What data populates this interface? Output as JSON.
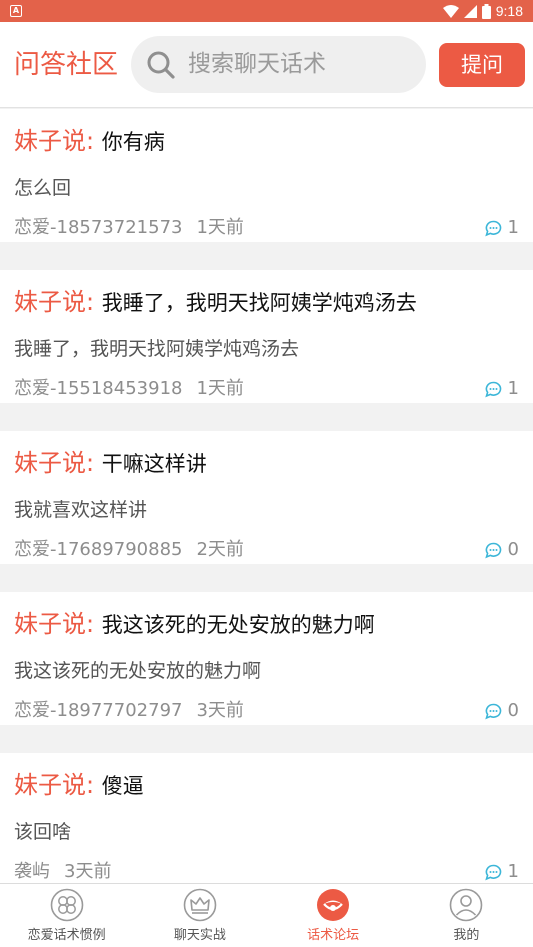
{
  "status_bar": {
    "time": "9:18",
    "app_badge": "A"
  },
  "header": {
    "title": "问答社区",
    "search_placeholder": "搜索聊天话术",
    "ask_button": "提问"
  },
  "posts": [
    {
      "prefix": "妹子说:",
      "question": "你有病",
      "answer": "怎么回",
      "author": "恋爱-18573721573",
      "ago": "1天前",
      "comments": "1"
    },
    {
      "prefix": "妹子说:",
      "question": "我睡了，我明天找阿姨学炖鸡汤去",
      "answer": "我睡了，我明天找阿姨学炖鸡汤去",
      "author": "恋爱-15518453918",
      "ago": "1天前",
      "comments": "1"
    },
    {
      "prefix": "妹子说:",
      "question": "干嘛这样讲",
      "answer": "我就喜欢这样讲",
      "author": "恋爱-17689790885",
      "ago": "2天前",
      "comments": "0"
    },
    {
      "prefix": "妹子说:",
      "question": "我这该死的无处安放的魅力啊",
      "answer": "我这该死的无处安放的魅力啊",
      "author": "恋爱-18977702797",
      "ago": "3天前",
      "comments": "0"
    },
    {
      "prefix": "妹子说:",
      "question": "傻逼",
      "answer": "该回啥",
      "author": "袭屿",
      "ago": "3天前",
      "comments": "1"
    }
  ],
  "tabs": [
    {
      "label": "恋爱话术惯例",
      "icon": "clover-icon"
    },
    {
      "label": "聊天实战",
      "icon": "crown-icon"
    },
    {
      "label": "话术论坛",
      "icon": "forum-icon",
      "active": true
    },
    {
      "label": "我的",
      "icon": "profile-icon"
    }
  ],
  "colors": {
    "accent": "#ec5a44",
    "status_bar": "#e3624a",
    "comment_icon": "#3cb6d8"
  }
}
